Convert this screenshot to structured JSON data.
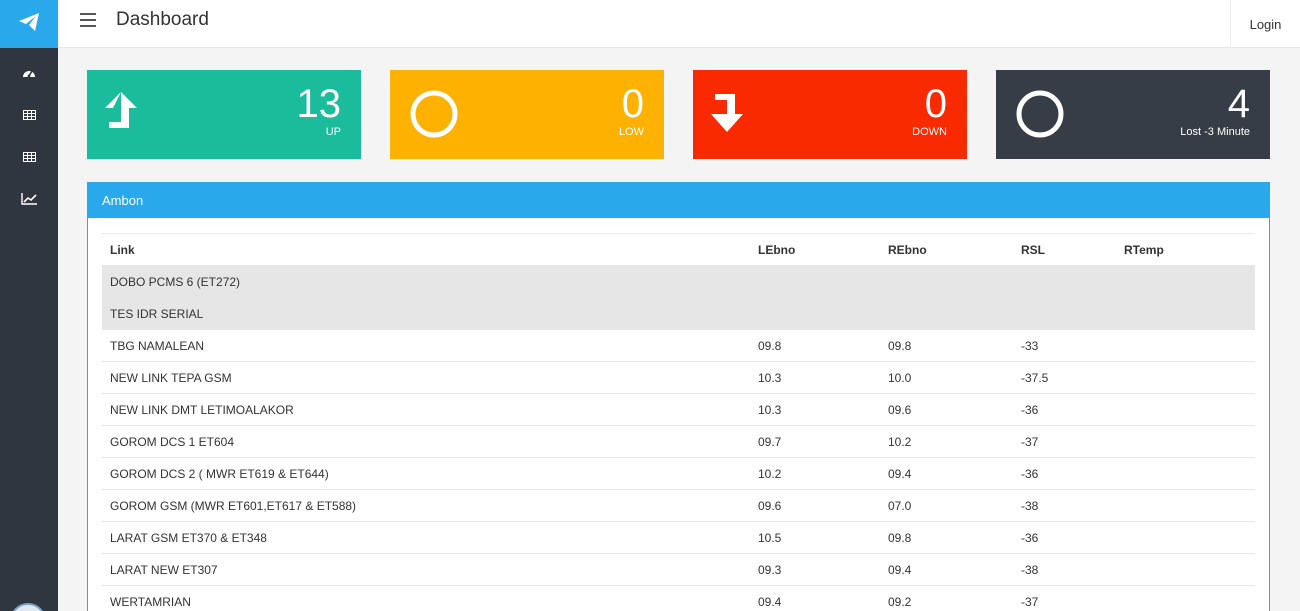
{
  "header": {
    "title": "Dashboard",
    "login_label": "Login"
  },
  "sidebar": {
    "items": [
      {
        "icon": "dashboard-icon"
      },
      {
        "icon": "table-icon"
      },
      {
        "icon": "table-icon"
      },
      {
        "icon": "line-chart-icon"
      }
    ]
  },
  "stats": [
    {
      "value": "13",
      "label": "UP",
      "color": "#1abc9c",
      "icon": "arrow-up-icon"
    },
    {
      "value": "0",
      "label": "LOW",
      "color": "#ffb100",
      "icon": "ring-icon"
    },
    {
      "value": "0",
      "label": "DOWN",
      "color": "#fa2a00",
      "icon": "arrow-down-icon"
    },
    {
      "value": "4",
      "label": "Lost -3 Minute",
      "color": "#363d47",
      "icon": "ring-icon"
    }
  ],
  "panel": {
    "title": "Ambon",
    "columns": [
      "Link",
      "LEbno",
      "REbno",
      "RSL",
      "RTemp"
    ],
    "rows": [
      {
        "link": "DOBO PCMS 6 (ET272)",
        "lebno": "",
        "rebno": "",
        "rsl": "",
        "rtemp": "",
        "down": true
      },
      {
        "link": "TES IDR SERIAL",
        "lebno": "",
        "rebno": "",
        "rsl": "",
        "rtemp": "",
        "down": true
      },
      {
        "link": "TBG NAMALEAN",
        "lebno": "09.8",
        "rebno": "09.8",
        "rsl": "-33",
        "rtemp": ""
      },
      {
        "link": "NEW LINK TEPA GSM",
        "lebno": "10.3",
        "rebno": "10.0",
        "rsl": "-37.5",
        "rtemp": ""
      },
      {
        "link": "NEW LINK DMT LETIMOALAKOR",
        "lebno": "10.3",
        "rebno": "09.6",
        "rsl": "-36",
        "rtemp": ""
      },
      {
        "link": "GOROM DCS 1 ET604",
        "lebno": "09.7",
        "rebno": "10.2",
        "rsl": "-37",
        "rtemp": ""
      },
      {
        "link": "GOROM DCS 2 ( MWR ET619 & ET644)",
        "lebno": "10.2",
        "rebno": "09.4",
        "rsl": "-36",
        "rtemp": ""
      },
      {
        "link": "GOROM GSM (MWR ET601,ET617 & ET588)",
        "lebno": "09.6",
        "rebno": "07.0",
        "rsl": "-38",
        "rtemp": ""
      },
      {
        "link": "LARAT GSM ET370 & ET348",
        "lebno": "10.5",
        "rebno": "09.8",
        "rsl": "-36",
        "rtemp": ""
      },
      {
        "link": "LARAT NEW ET307",
        "lebno": "09.3",
        "rebno": "09.4",
        "rsl": "-38",
        "rtemp": ""
      },
      {
        "link": "WERTAMRIAN",
        "lebno": "09.4",
        "rebno": "09.2",
        "rsl": "-37",
        "rtemp": ""
      }
    ]
  }
}
